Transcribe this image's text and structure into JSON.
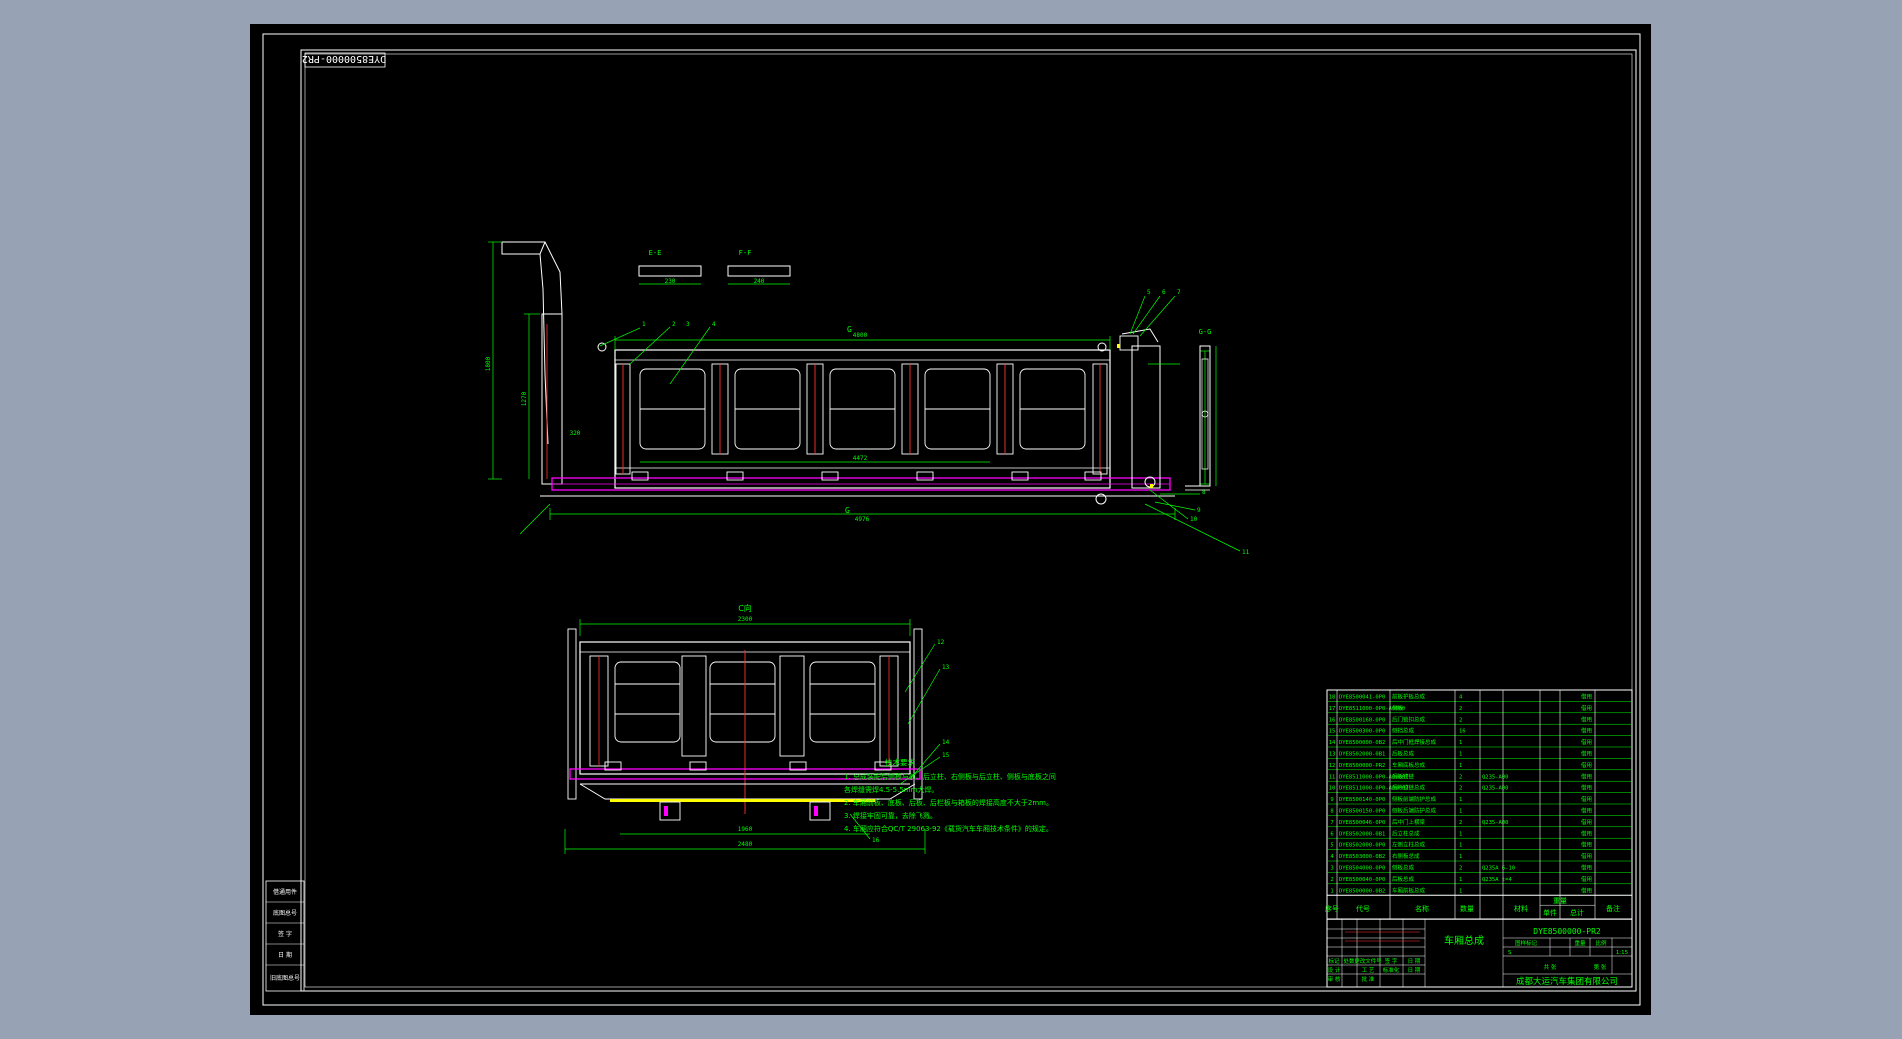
{
  "colors": {
    "background": "#97a3b4",
    "sheet": "#000000",
    "frame": "#ffffff",
    "dimension": "#00ff00",
    "part": "#ffffff",
    "hidden_line": "#ff3030",
    "floor": "#ff00ff",
    "fill": "#ffff00",
    "table_text": "#00ff00"
  },
  "drawing": {
    "code_stamp": "DYE8500000-PR2",
    "section_labels": {
      "g_g": "G-G",
      "c_view": "C向",
      "e_e": "E-E",
      "f_f": "F-F",
      "g_top": "G",
      "g_bottom": "G"
    },
    "dimension_texts": {
      "top_length": "4800",
      "bottom_length": "4976",
      "floor_span": "4472",
      "box_height": "1800",
      "side_height": "1270",
      "rear_offset": "320",
      "e_e_width": "230",
      "f_f_width": "240",
      "c_view_width": "2300",
      "c_view_bottom": "2480",
      "c_view_inner": "1960"
    },
    "balloons": [
      "1",
      "2",
      "3",
      "4",
      "5",
      "6",
      "7",
      "8",
      "9",
      "10",
      "11",
      "12",
      "13",
      "14",
      "15",
      "16",
      "17",
      "18"
    ]
  },
  "notes": {
    "title": "技术要求",
    "lines": [
      "1. 总成装配后侧板与前、后立柱、右侧板与后立柱、侧板与底板之间",
      "各焊缝需焊4.5-5.5mm大焊。",
      "2. 车厢前板、底板、后板、后栏板与箱板的焊接高度不大于2mm。",
      "3. 焊接牢固可靠，去除飞溅。",
      "4. 车厢应符合QC/T 29063-92《载货汽车车厢技术条件》的规定。"
    ]
  },
  "left_strip": {
    "cells": [
      "借通用件",
      "底图总号",
      "签 字",
      "日 期",
      "旧底图总号"
    ]
  },
  "parts_table": {
    "headers": [
      "序号",
      "代号",
      "名称",
      "数量",
      "材料",
      "单件",
      "总计",
      "备注"
    ],
    "weight_header": "重量",
    "rows": [
      {
        "no": "18",
        "code": "DYE8500041-0P0",
        "name": "前板护板总成",
        "qty": "4",
        "mat": "",
        "note": "借用"
      },
      {
        "no": "17",
        "code": "DYE8511000-0P0-A0000",
        "name": "侧板",
        "qty": "2",
        "mat": "",
        "note": "借用"
      },
      {
        "no": "16",
        "code": "DYE8500160-0P0",
        "name": "后门锁扣总成",
        "qty": "2",
        "mat": "",
        "note": "借用"
      },
      {
        "no": "15",
        "code": "DYE8500300-0P0",
        "name": "侧挡总成",
        "qty": "16",
        "mat": "",
        "note": "借用"
      },
      {
        "no": "14",
        "code": "DYE8500000-0B2",
        "name": "后中门框焊接总成",
        "qty": "1",
        "mat": "",
        "note": "借用"
      },
      {
        "no": "13",
        "code": "DYE8502000-0B1",
        "name": "后板总成",
        "qty": "1",
        "mat": "",
        "note": "借用"
      },
      {
        "no": "12",
        "code": "DYE8500000-PR2",
        "name": "车厢底板总成",
        "qty": "1",
        "mat": "",
        "note": "借用"
      },
      {
        "no": "11",
        "code": "DYE8511000-0P0-A0000I",
        "name": "后板铰链",
        "qty": "2",
        "mat": "Q235-A00",
        "note": "借用"
      },
      {
        "no": "10",
        "code": "DYE8511000-0P0-A0000J",
        "name": "后栏铰链总成",
        "qty": "2",
        "mat": "Q235-A00",
        "note": "借用"
      },
      {
        "no": "9",
        "code": "DYE8500140-0P0",
        "name": "侧板前端防护总成",
        "qty": "1",
        "mat": "",
        "note": "借用"
      },
      {
        "no": "8",
        "code": "DYE8500150-0P0",
        "name": "侧板后端防护总成",
        "qty": "1",
        "mat": "",
        "note": "借用"
      },
      {
        "no": "7",
        "code": "DYE8500046-0P0",
        "name": "后中门上横梁",
        "qty": "2",
        "mat": "Q235-A00",
        "note": "借用"
      },
      {
        "no": "6",
        "code": "DYE8502000-0B1",
        "name": "后立柱总成",
        "qty": "1",
        "mat": "",
        "note": "借用"
      },
      {
        "no": "5",
        "code": "DYE8502000-0P0",
        "name": "左侧立柱总成",
        "qty": "1",
        "mat": "",
        "note": "借用"
      },
      {
        "no": "4",
        "code": "DYE8503000-0B2",
        "name": "右侧板总成",
        "qty": "1",
        "mat": "",
        "note": "借用"
      },
      {
        "no": "3",
        "code": "DYE8504000-0P0",
        "name": "侧板总成",
        "qty": "2",
        "mat": "Q235A 6-10",
        "note": "借用"
      },
      {
        "no": "2",
        "code": "DYE8500040-0P0",
        "name": "后板总成",
        "qty": "1",
        "mat": "Q235A t=4",
        "note": "借用"
      },
      {
        "no": "1",
        "code": "DYE8500000-0B2",
        "name": "车厢前板总成",
        "qty": "1",
        "mat": "",
        "note": "借用"
      }
    ]
  },
  "title_block": {
    "code": "DYE8500000-PR2",
    "name": "车厢总成",
    "stage_label": "图样标记",
    "weight_label": "重量",
    "scale_label": "比例",
    "scale_value": "1:15",
    "sheet_label": "共  张",
    "sheet_no": "第  张",
    "company": "成都大运汽车集团有限公司",
    "change_row": [
      "标记",
      "处数",
      "更改文件号",
      "签 字",
      "日 期"
    ],
    "roles": [
      "设 计",
      "审 核",
      "工 艺",
      "批 准"
    ],
    "roles2": [
      "标准化",
      "日 期"
    ],
    "row_s": "S"
  }
}
